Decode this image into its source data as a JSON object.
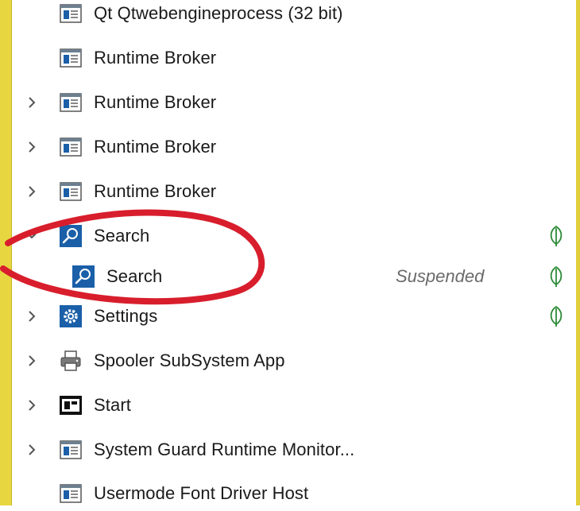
{
  "colors": {
    "accent_blue": "#1a5fa8",
    "leaf_green": "#2e8b3a",
    "annotation_red": "#d81e2c",
    "window_border_yellow": "#e8d640"
  },
  "processes": [
    {
      "label": "Qt Qtwebengineprocess (32 bit)",
      "icon": "window-app-icon",
      "expander": "none",
      "status": "",
      "eco": false
    },
    {
      "label": "Runtime Broker",
      "icon": "window-app-icon",
      "expander": "none",
      "status": "",
      "eco": false
    },
    {
      "label": "Runtime Broker",
      "icon": "window-app-icon",
      "expander": "collapsed",
      "status": "",
      "eco": false
    },
    {
      "label": "Runtime Broker",
      "icon": "window-app-icon",
      "expander": "collapsed",
      "status": "",
      "eco": false
    },
    {
      "label": "Runtime Broker",
      "icon": "window-app-icon",
      "expander": "collapsed",
      "status": "",
      "eco": false
    },
    {
      "label": "Search",
      "icon": "search-icon",
      "expander": "expanded",
      "status": "",
      "eco": true
    },
    {
      "label": "Search",
      "icon": "search-icon",
      "expander": "none",
      "status": "Suspended",
      "eco": true
    },
    {
      "label": "Settings",
      "icon": "gear-icon",
      "expander": "collapsed",
      "status": "",
      "eco": true
    },
    {
      "label": "Spooler SubSystem App",
      "icon": "printer-icon",
      "expander": "collapsed",
      "status": "",
      "eco": false
    },
    {
      "label": "Start",
      "icon": "start-icon",
      "expander": "collapsed",
      "status": "",
      "eco": false
    },
    {
      "label": "System Guard Runtime Monitor...",
      "icon": "window-app-icon",
      "expander": "collapsed",
      "status": "",
      "eco": false
    },
    {
      "label": "Usermode Font Driver Host",
      "icon": "window-app-icon",
      "expander": "none",
      "status": "",
      "eco": false
    }
  ]
}
